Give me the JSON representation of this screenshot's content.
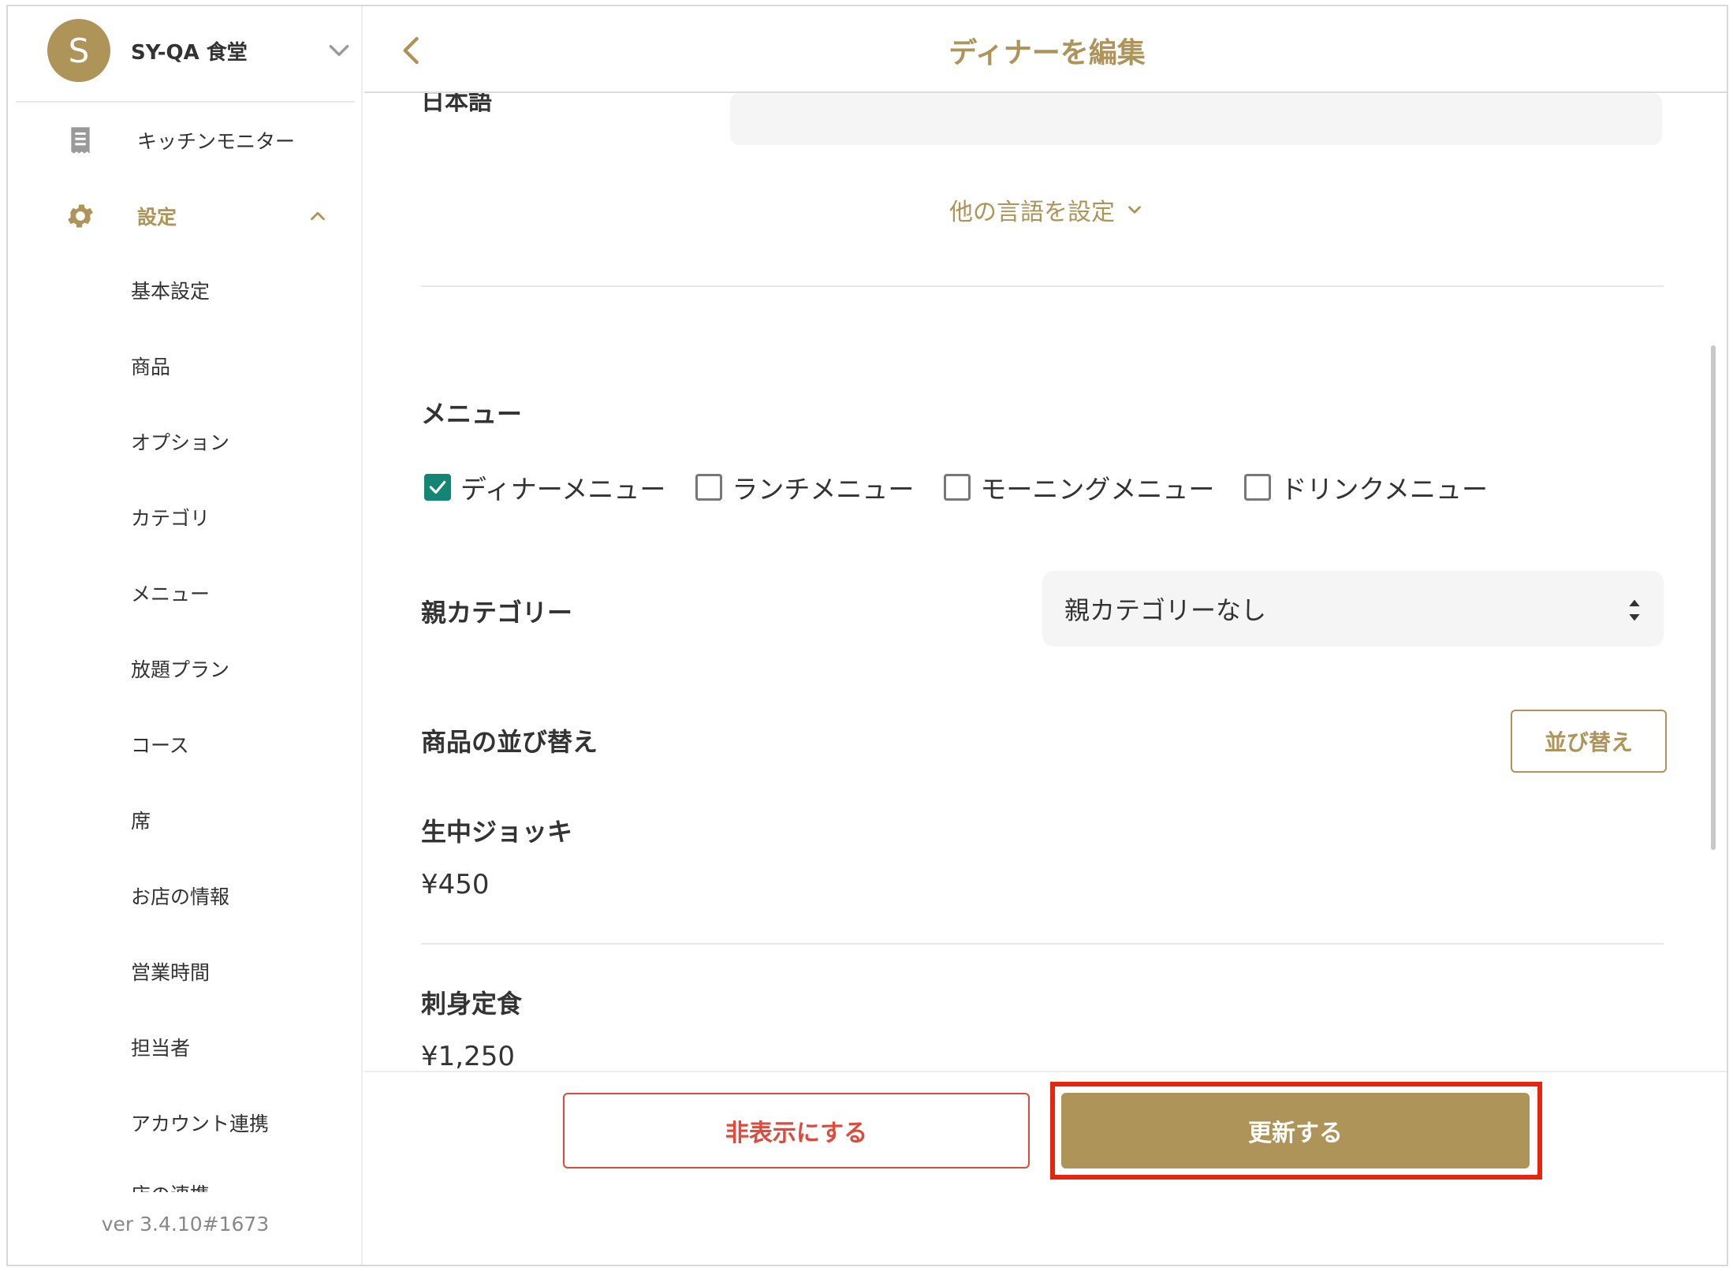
{
  "colors": {
    "accent": "#ae9458",
    "danger": "#e0493c",
    "checkbox": "#128573",
    "highlight": "#e8240e"
  },
  "sidebar": {
    "store_initial": "S",
    "store_name": "SY-QA 食堂",
    "kitchen_monitor": "キッチンモニター",
    "settings_label": "設定",
    "items": [
      {
        "label": "基本設定"
      },
      {
        "label": "商品"
      },
      {
        "label": "オプション"
      },
      {
        "label": "カテゴリ"
      },
      {
        "label": "メニュー"
      },
      {
        "label": "放題プラン"
      },
      {
        "label": "コース"
      },
      {
        "label": "席"
      },
      {
        "label": "お店の情報"
      },
      {
        "label": "営業時間"
      },
      {
        "label": "担当者"
      },
      {
        "label": "アカウント連携"
      },
      {
        "label": "店の連携"
      }
    ],
    "version": "ver 3.4.10#1673"
  },
  "header": {
    "title": "ディナーを編集"
  },
  "form": {
    "language_label": "日本語",
    "other_languages": "他の言語を設定",
    "menu_title": "メニュー",
    "menus": [
      {
        "label": "ディナーメニュー",
        "checked": true
      },
      {
        "label": "ランチメニュー",
        "checked": false
      },
      {
        "label": "モーニングメニュー",
        "checked": false
      },
      {
        "label": "ドリンクメニュー",
        "checked": false
      }
    ],
    "parent_category_label": "親カテゴリー",
    "parent_category_value": "親カテゴリーなし",
    "sort_label": "商品の並び替え",
    "sort_button": "並び替え",
    "products": [
      {
        "name": "生中ジョッキ",
        "price": "¥450"
      },
      {
        "name": "刺身定食",
        "price": "¥1,250"
      }
    ]
  },
  "footer": {
    "hide_button": "非表示にする",
    "update_button": "更新する"
  }
}
